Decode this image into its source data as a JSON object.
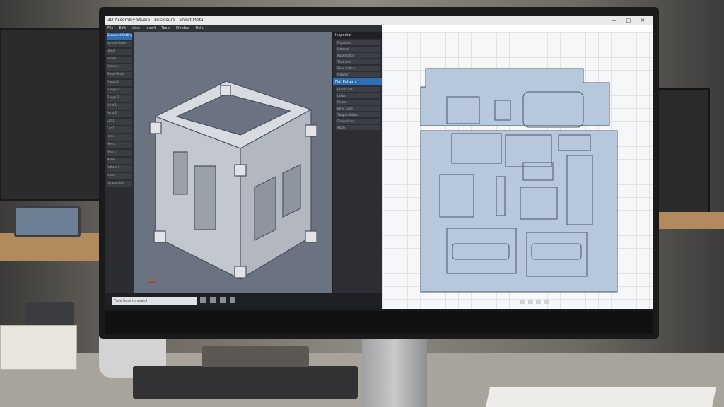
{
  "window": {
    "title": "3D Assembly Studio - Enclosure - Sheet Metal",
    "controls": [
      "—",
      "□",
      "✕"
    ]
  },
  "menu": {
    "items": [
      "File",
      "Edit",
      "View",
      "Insert",
      "Tools",
      "Window",
      "Help"
    ]
  },
  "browser_tree": {
    "items": [
      "Document Settings",
      "Named Views",
      "Origin",
      "Bodies",
      "Sketches",
      "Sheet Metal",
      "Flange 1",
      "Flange 2",
      "Flange 3",
      "Bend 1",
      "Bend 2",
      "Cut 1",
      "Cut 2",
      "Hole 1",
      "Hole 2",
      "Fillet 1",
      "Mirror 1",
      "Pattern 1",
      "Joints",
      "Components"
    ]
  },
  "properties_panel": {
    "header1": "Inspector",
    "rows1": [
      "Properties",
      "Material",
      "Appearance",
      "Thickness",
      "Bend Radius",
      "K-Factor"
    ],
    "header2": "Flat Pattern",
    "rows2": [
      "Export DXF",
      "Unfold",
      "Refold",
      "Bend Lines",
      "Tangent Edges",
      "Dimensions",
      "Apply"
    ]
  },
  "taskbar": {
    "search_placeholder": "Type here to search"
  },
  "colors": {
    "accent": "#2f6db5",
    "viewport_bg": "#6b7280",
    "flat_pattern_fill": "#b8c8dc",
    "flat_pattern_stroke": "#4a5566",
    "model_fill": "#c9ccd2"
  },
  "icons": [
    "viewcube-icon",
    "axis-triad-icon",
    "windows-start-icon",
    "tray-icons"
  ]
}
